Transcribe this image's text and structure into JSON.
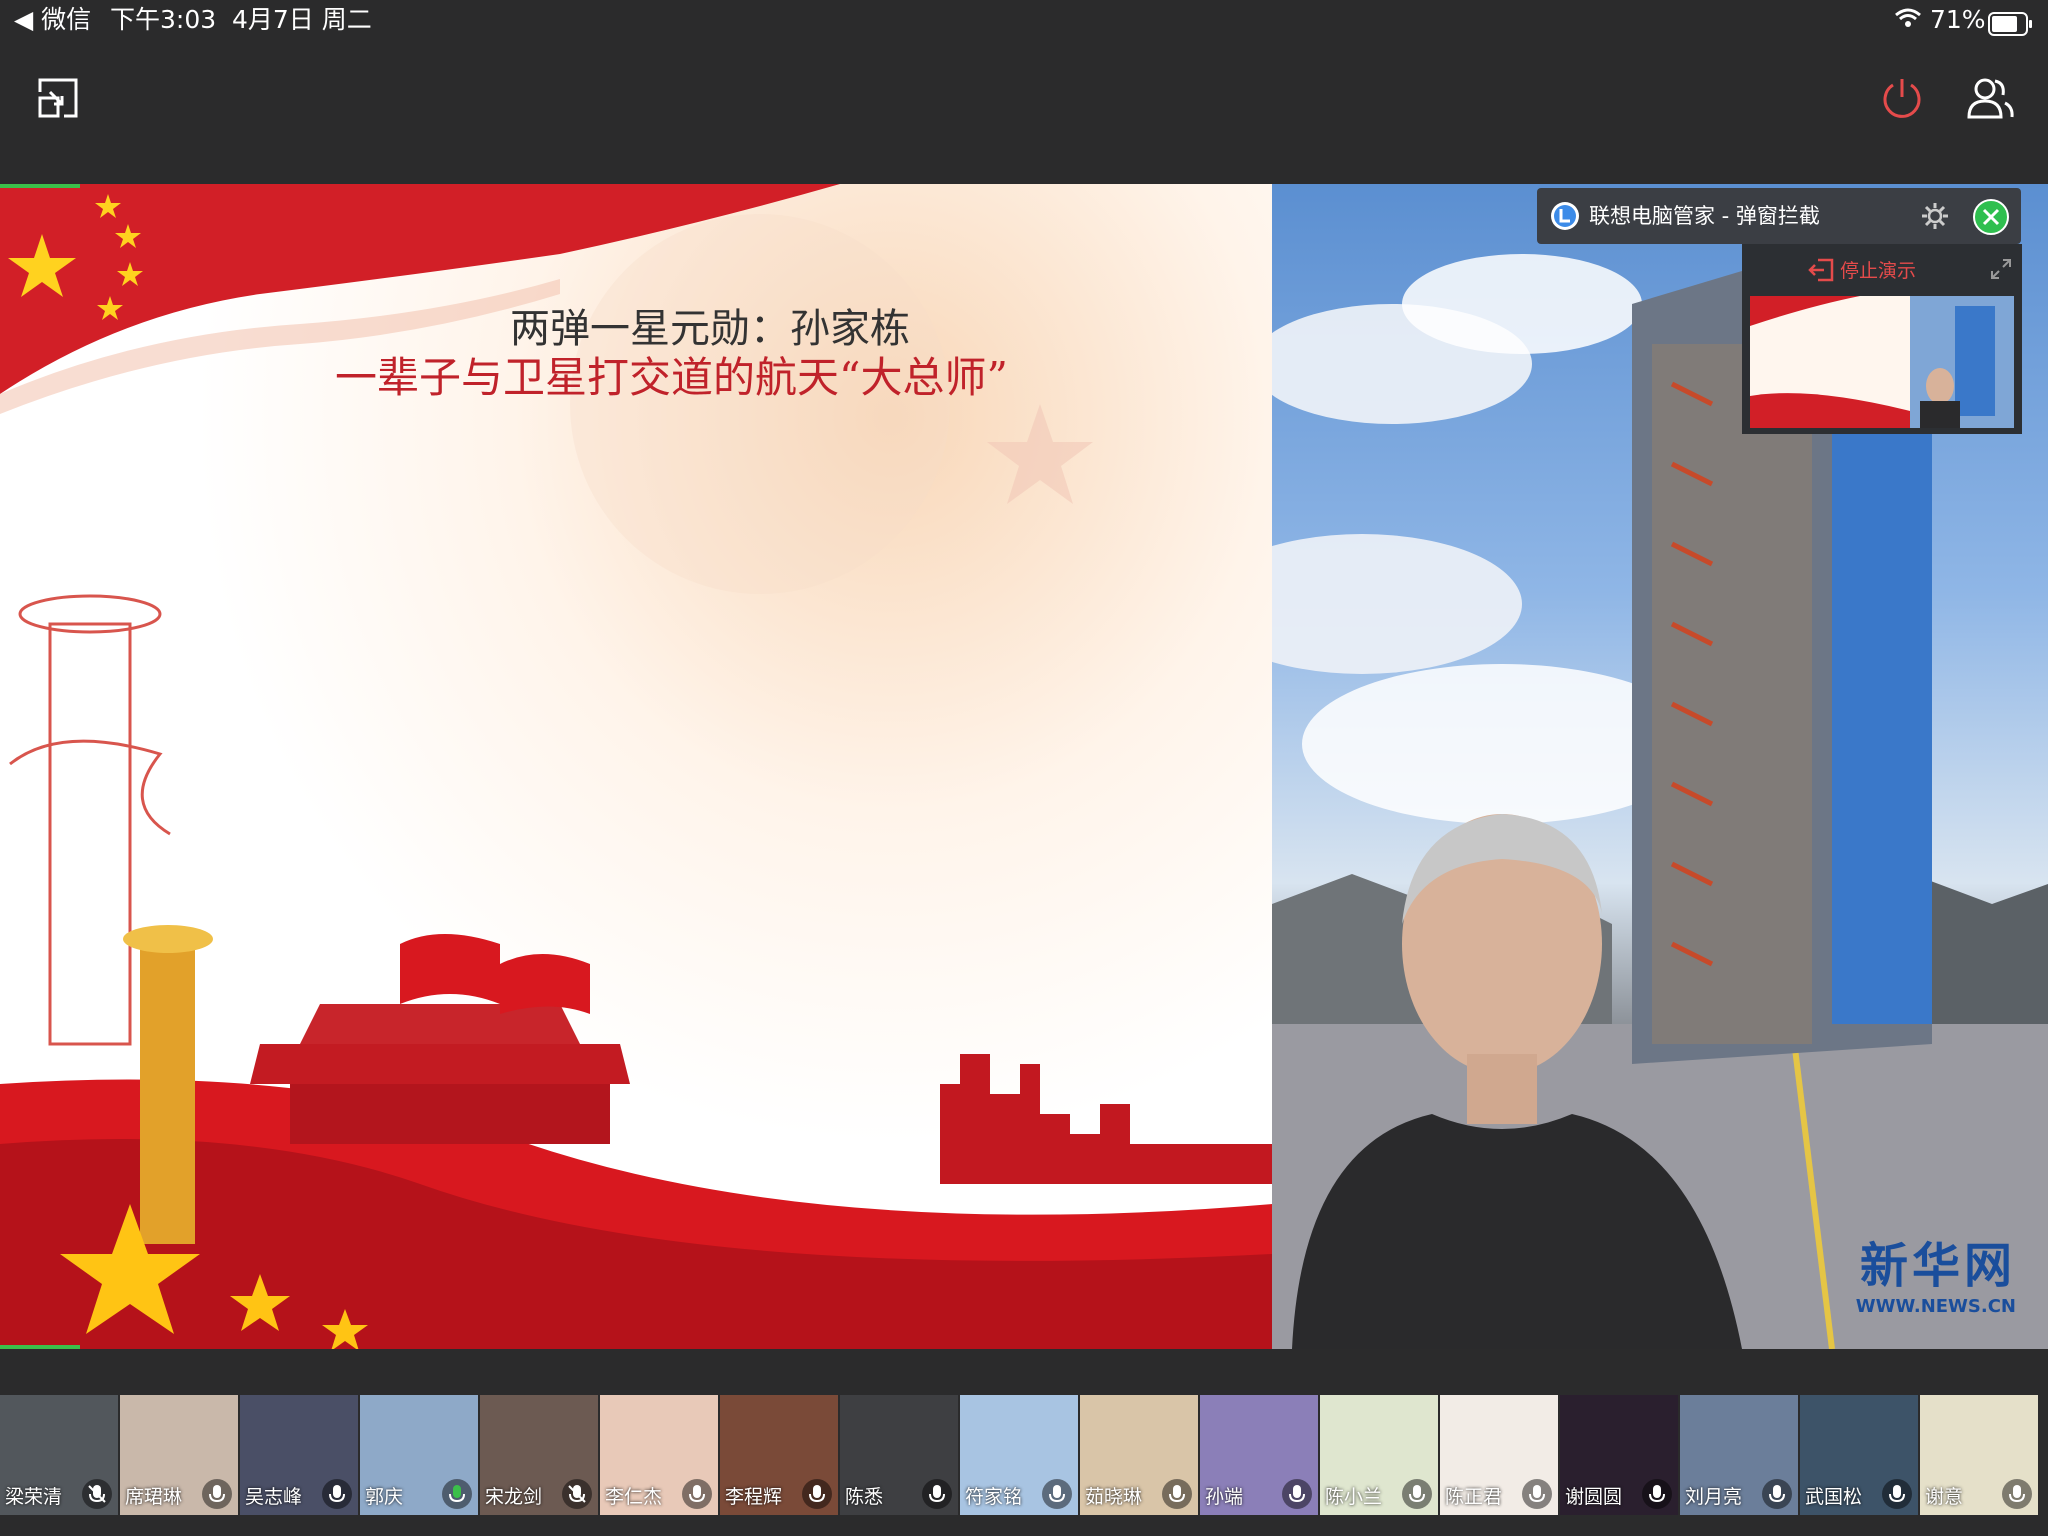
{
  "status": {
    "back_app": "◀ 微信",
    "time": "下午3:03",
    "date": "4月7日 周二",
    "battery": "71%"
  },
  "slide": {
    "title": "两弹一星元勋：孙家栋",
    "subtitle": "一辈子与卫星打交道的航天“大总师”"
  },
  "photo": {
    "watermark_main": "新华网",
    "watermark_sub": "WWW.NEWS.CN"
  },
  "popup": {
    "title": "联想电脑管家 - 弹窗拦截",
    "stop_label": "停止演示"
  },
  "participants": [
    {
      "name": "梁荣清",
      "mic": "muted"
    },
    {
      "name": "席珺琳",
      "mic": "off"
    },
    {
      "name": "吴志峰",
      "mic": "off"
    },
    {
      "name": "郭庆",
      "mic": "active"
    },
    {
      "name": "宋龙剑",
      "mic": "muted"
    },
    {
      "name": "李仁杰",
      "mic": "off"
    },
    {
      "name": "李程辉",
      "mic": "off"
    },
    {
      "name": "陈悉",
      "mic": "off"
    },
    {
      "name": "符家铭",
      "mic": "off"
    },
    {
      "name": "茹晓琳",
      "mic": "off"
    },
    {
      "name": "孙端",
      "mic": "off"
    },
    {
      "name": "陈小兰",
      "mic": "off"
    },
    {
      "name": "陈正君",
      "mic": "off"
    },
    {
      "name": "谢圆圆",
      "mic": "off"
    },
    {
      "name": "刘月亮",
      "mic": "off"
    },
    {
      "name": "武国松",
      "mic": "off"
    },
    {
      "name": "谢意",
      "mic": "off"
    }
  ],
  "colors": {
    "accent_red": "#e54b4b",
    "active_green": "#3bbf4a",
    "popup_close": "#2fbf4f"
  }
}
